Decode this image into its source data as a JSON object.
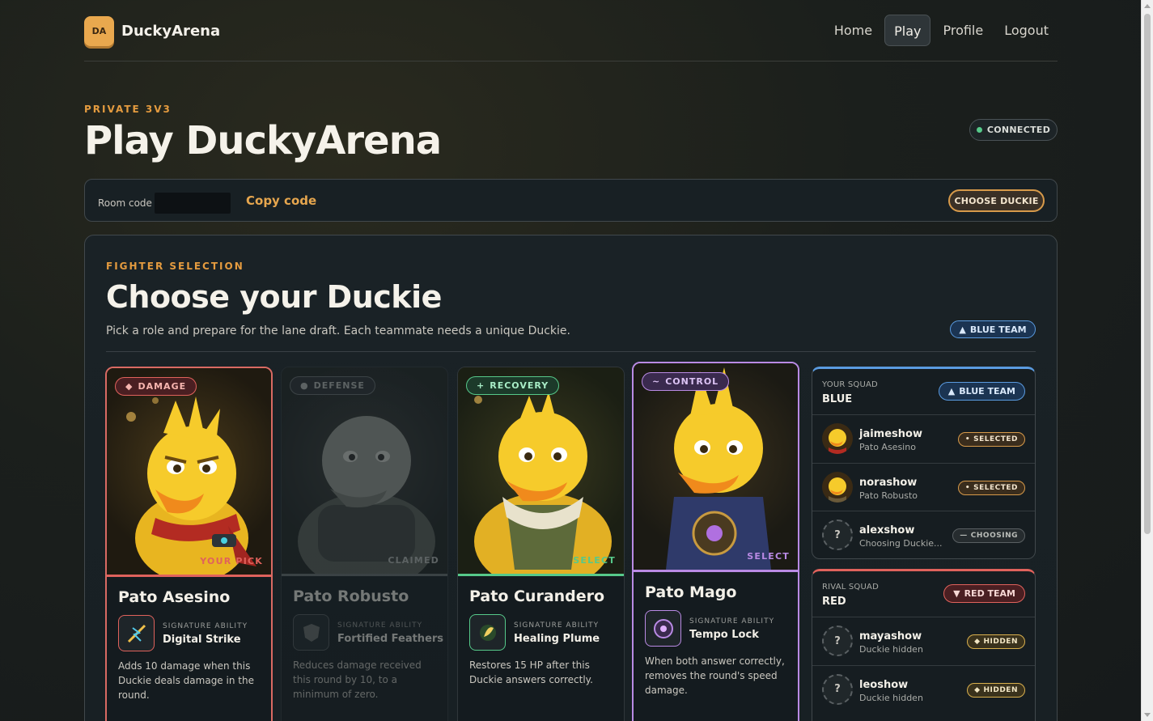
{
  "app": {
    "logo_badge": "DA",
    "logo_text": "DuckyArena"
  },
  "nav": {
    "home": "Home",
    "play": "Play",
    "profile": "Profile",
    "logout": "Logout"
  },
  "hero": {
    "eyebrow": "PRIVATE 3V3",
    "title": "Play DuckyArena",
    "status": "CONNECTED"
  },
  "room": {
    "label": "Room code",
    "copy": "Copy code",
    "choose_button": "CHOOSE DUCKIE"
  },
  "selection": {
    "eyebrow": "FIGHTER SELECTION",
    "title": "Choose your Duckie",
    "subtitle": "Pick a role and prepare for the lane draft. Each teammate needs a unique Duckie.",
    "team_badge": "BLUE TEAM"
  },
  "cards": [
    {
      "role": "DAMAGE",
      "role_icon": "diamond-icon",
      "name": "Pato Asesino",
      "pick_label": "YOUR PICK",
      "ability_kicker": "SIGNATURE ABILITY",
      "ability": "Digital Strike",
      "description": "Adds 10 damage when this Duckie deals damage in the round.",
      "color": "#e0625c"
    },
    {
      "role": "DEFENSE",
      "role_icon": "dot-icon",
      "name": "Pato Robusto",
      "pick_label": "CLAIMED",
      "ability_kicker": "SIGNATURE ABILITY",
      "ability": "Fortified Feathers",
      "description": "Reduces damage received this round by 10, to a minimum of zero.",
      "color": "#8a8f8c"
    },
    {
      "role": "RECOVERY",
      "role_icon": "plus-icon",
      "name": "Pato Curandero",
      "pick_label": "SELECT",
      "ability_kicker": "SIGNATURE ABILITY",
      "ability": "Healing Plume",
      "description": "Restores 15 HP after this Duckie answers correctly.",
      "color": "#56c98a"
    },
    {
      "role": "CONTROL",
      "role_icon": "wave-icon",
      "name": "Pato Mago",
      "pick_label": "SELECT",
      "ability_kicker": "SIGNATURE ABILITY",
      "ability": "Tempo Lock",
      "description": "When both answer correctly, removes the round's speed damage.",
      "color": "#b98ae4"
    }
  ],
  "blue_squad": {
    "kicker": "YOUR SQUAD",
    "name": "BLUE",
    "badge": "BLUE TEAM",
    "members": [
      {
        "name": "jaimeshow",
        "sub": "Pato Asesino",
        "status": "SELECTED"
      },
      {
        "name": "norashow",
        "sub": "Pato Robusto",
        "status": "SELECTED"
      },
      {
        "name": "alexshow",
        "sub": "Choosing Duckie...",
        "status": "CHOOSING",
        "avatar": "?"
      }
    ]
  },
  "red_squad": {
    "kicker": "RIVAL SQUAD",
    "name": "RED",
    "badge": "RED TEAM",
    "members": [
      {
        "name": "mayashow",
        "sub": "Duckie hidden",
        "status": "HIDDEN",
        "avatar": "?"
      },
      {
        "name": "leoshow",
        "sub": "Duckie hidden",
        "status": "HIDDEN",
        "avatar": "?"
      }
    ]
  }
}
